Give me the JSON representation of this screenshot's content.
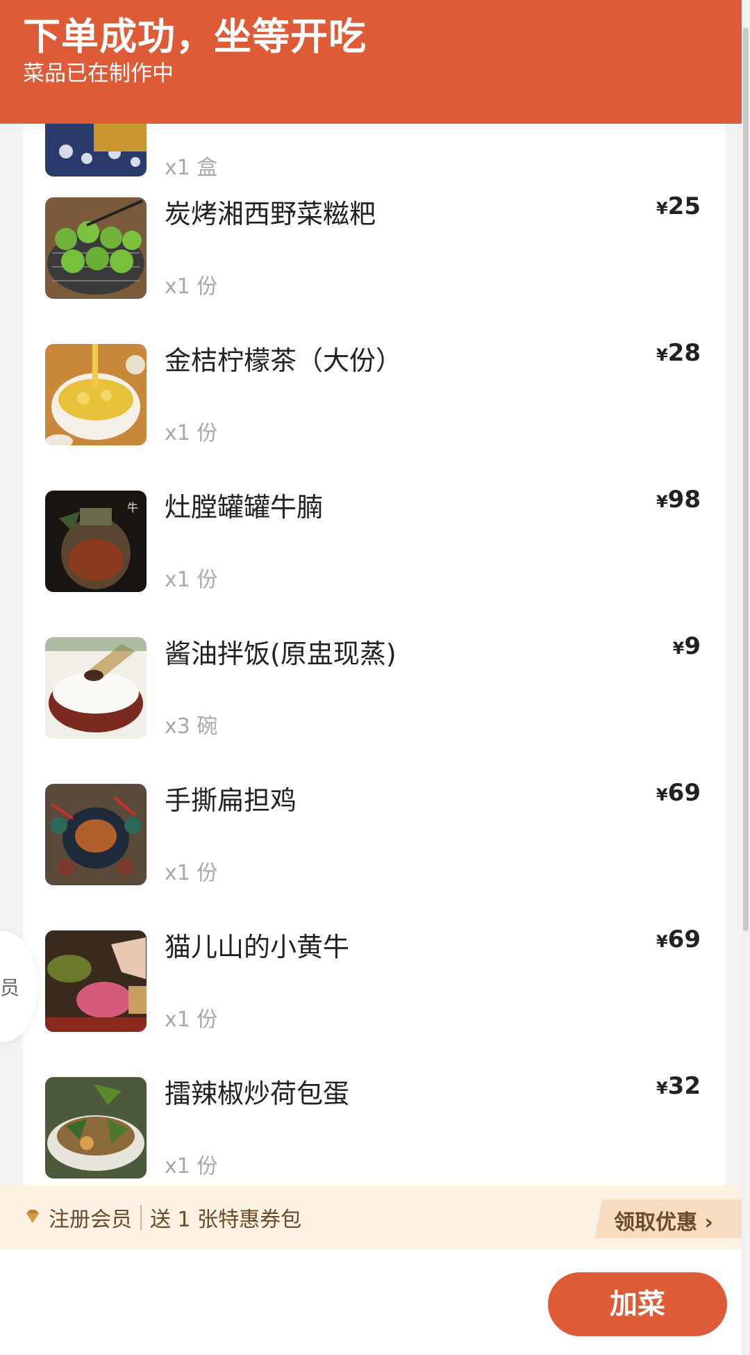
{
  "header": {
    "title": "下单成功，坐等开吃",
    "subtitle": "菜品已在制作中"
  },
  "partial_item": {
    "qty": "x1 盒"
  },
  "items": [
    {
      "name": "炭烤湘西野菜糍粑",
      "qty": "x1 份",
      "currency": "¥",
      "price": "25"
    },
    {
      "name": "金桔柠檬茶（大份）",
      "qty": "x1 份",
      "currency": "¥",
      "price": "28"
    },
    {
      "name": "灶膛罐罐牛腩",
      "qty": "x1 份",
      "currency": "¥",
      "price": "98"
    },
    {
      "name": "酱油拌饭(原盅现蒸)",
      "qty": "x3 碗",
      "currency": "¥",
      "price": "9"
    },
    {
      "name": "手撕扁担鸡",
      "qty": "x1 份",
      "currency": "¥",
      "price": "69"
    },
    {
      "name": "猫儿山的小黄牛",
      "qty": "x1 份",
      "currency": "¥",
      "price": "69"
    },
    {
      "name": "擂辣椒炒荷包蛋",
      "qty": "x1 份",
      "currency": "¥",
      "price": "32"
    }
  ],
  "side_bubble": {
    "label": "员"
  },
  "promo": {
    "register": "注册会员",
    "gift": "送 1 张特惠券包",
    "claim": "领取优惠 ›"
  },
  "footer": {
    "add_button": "加菜"
  }
}
